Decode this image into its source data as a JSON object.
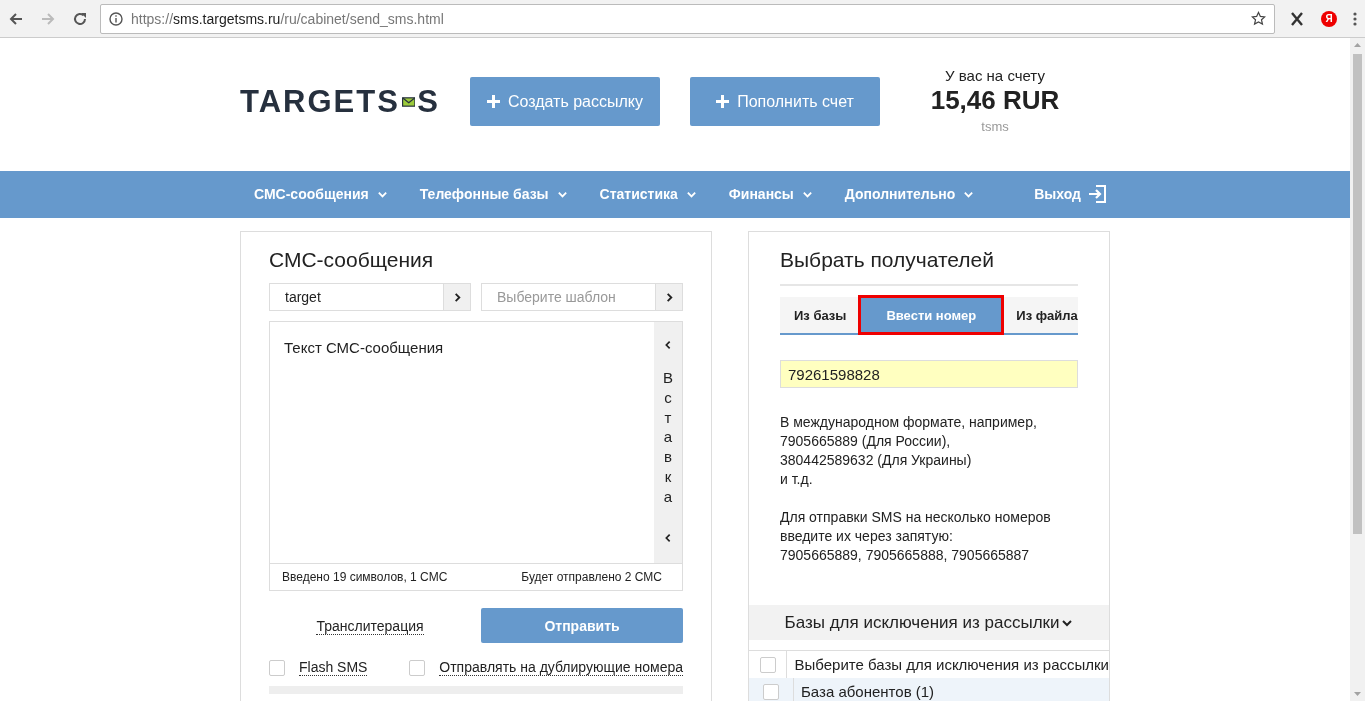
{
  "browser": {
    "url_scheme": "https://",
    "url_host": "sms.targetsms.ru",
    "url_path": "/ru/cabinet/send_sms.html",
    "extension_badge": "Я"
  },
  "header": {
    "logo_before": "TARGETS",
    "logo_after": "S",
    "buttons": [
      "Создать рассылку",
      "Пополнить счет"
    ],
    "balance_label": "У вас на счету",
    "balance": "15,46 RUR",
    "balance_unit": "tsms"
  },
  "nav": {
    "items": [
      "СМС-сообщения",
      "Телефонные базы",
      "Статистика",
      "Финансы",
      "Дополнительно"
    ],
    "exit": "Выход"
  },
  "sms_panel": {
    "title": "СМС-сообщения",
    "sender": "target",
    "template_placeholder": "Выберите шаблон",
    "message": "Текст СМС-сообщения",
    "insert_label": "Вставка",
    "typed_count": "Введено 19 символов, 1 СМС",
    "send_count": "Будет отправлено 2 СМС",
    "transliteration": "Транслитерация",
    "send": "Отправить",
    "options": [
      {
        "label": "Flash SMS",
        "checked": false
      },
      {
        "label": "Отправлять на дублирующие номера",
        "checked": false
      }
    ]
  },
  "recipients_panel": {
    "title": "Выбрать получателей",
    "tabs": [
      {
        "label": "Из базы",
        "selected": false
      },
      {
        "label": "Ввести номер",
        "selected": true
      },
      {
        "label": "Из файла",
        "selected": false
      }
    ],
    "phone": "79261598828",
    "help": [
      "В международном формате, например,\n7905665889 (Для России),\n380442589632 (Для Украины)\nи т.д.",
      "Для отправки SMS на несколько номеров\nвведите их через запятую:\n7905665889, 7905665888, 7905665887"
    ],
    "exclusions_title": "Базы для исключения из рассылки",
    "exclusions": [
      {
        "label": "Выберите базы для исключения из рассылки",
        "checked": false
      },
      {
        "label": "База абонентов (1)",
        "checked": false
      }
    ]
  }
}
